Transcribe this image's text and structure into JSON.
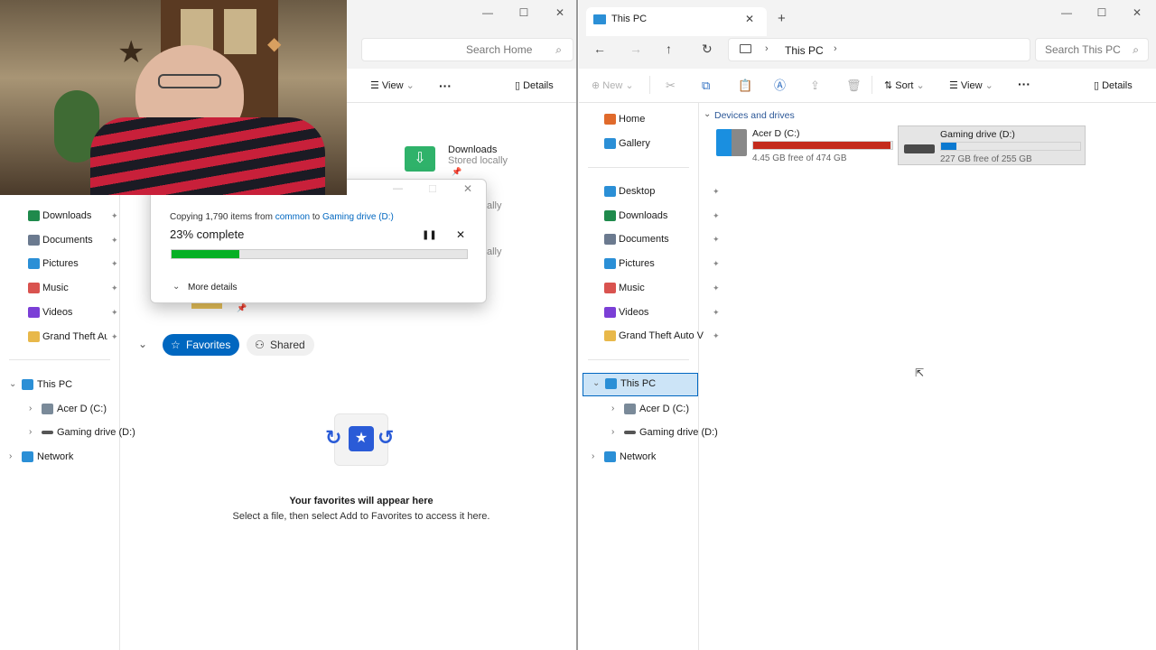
{
  "webcam": {
    "overlay": "webcam-feed"
  },
  "left_window": {
    "search_placeholder": "Search Home",
    "toolbar": {
      "view": "View",
      "more": "···",
      "details": "Details"
    },
    "quick_access": [
      {
        "name": "Downloads",
        "status": "Stored locally"
      },
      {
        "name": "",
        "status": "ally"
      },
      {
        "name": "",
        "status": "ally"
      }
    ],
    "nav": [
      {
        "label": "Downloads",
        "icon": "download-icon"
      },
      {
        "label": "Documents",
        "icon": "document-icon"
      },
      {
        "label": "Pictures",
        "icon": "pictures-icon"
      },
      {
        "label": "Music",
        "icon": "music-icon"
      },
      {
        "label": "Videos",
        "icon": "videos-icon"
      },
      {
        "label": "Grand Theft Auto V",
        "icon": "folder-icon"
      }
    ],
    "tree": [
      {
        "label": "This PC"
      },
      {
        "label": "Acer D  (C:)"
      },
      {
        "label": "Gaming drive (D:)"
      },
      {
        "label": "Network"
      }
    ],
    "tabs": {
      "favorites": "Favorites",
      "shared": "Shared"
    },
    "empty": {
      "title": "Your favorites will appear here",
      "subtitle": "Select a file, then select Add to Favorites to access it here."
    }
  },
  "copy_dialog": {
    "prefix": "Copying 1,790 items from ",
    "source": "common",
    "mid": " to ",
    "dest": "Gaming drive (D:)",
    "status": "23% complete",
    "progress_fraction": 0.23,
    "more_details": "More details",
    "pause_icon": "pause-icon",
    "close_icon": "close-icon"
  },
  "right_window": {
    "tab_title": "This PC",
    "breadcrumb": [
      "This PC"
    ],
    "search_placeholder": "Search This PC",
    "toolbar": {
      "new": "New",
      "sort": "Sort",
      "view": "View",
      "more": "···",
      "details": "Details"
    },
    "nav_top": [
      {
        "label": "Home",
        "icon": "home-icon"
      },
      {
        "label": "Gallery",
        "icon": "gallery-icon"
      }
    ],
    "nav": [
      {
        "label": "Desktop",
        "icon": "desktop-icon"
      },
      {
        "label": "Downloads",
        "icon": "download-icon"
      },
      {
        "label": "Documents",
        "icon": "document-icon"
      },
      {
        "label": "Pictures",
        "icon": "pictures-icon"
      },
      {
        "label": "Music",
        "icon": "music-icon"
      },
      {
        "label": "Videos",
        "icon": "videos-icon"
      },
      {
        "label": "Grand Theft Auto V",
        "icon": "folder-icon"
      }
    ],
    "tree": [
      {
        "label": "This PC"
      },
      {
        "label": "Acer D  (C:)"
      },
      {
        "label": "Gaming drive (D:)"
      },
      {
        "label": "Network"
      }
    ],
    "section_title": "Devices and drives",
    "drives": [
      {
        "name": "Acer D  (C:)",
        "free": "4.45 GB free of 474 GB",
        "used_fraction": 0.99,
        "color": "#c42b1c"
      },
      {
        "name": "Gaming drive (D:)",
        "free": "227 GB free of 255 GB",
        "used_fraction": 0.11,
        "color": "#0b79d0"
      }
    ]
  },
  "colors": {
    "accent": "#0067c0",
    "selected": "#cce4f7",
    "copy_progress": "#06b025"
  }
}
